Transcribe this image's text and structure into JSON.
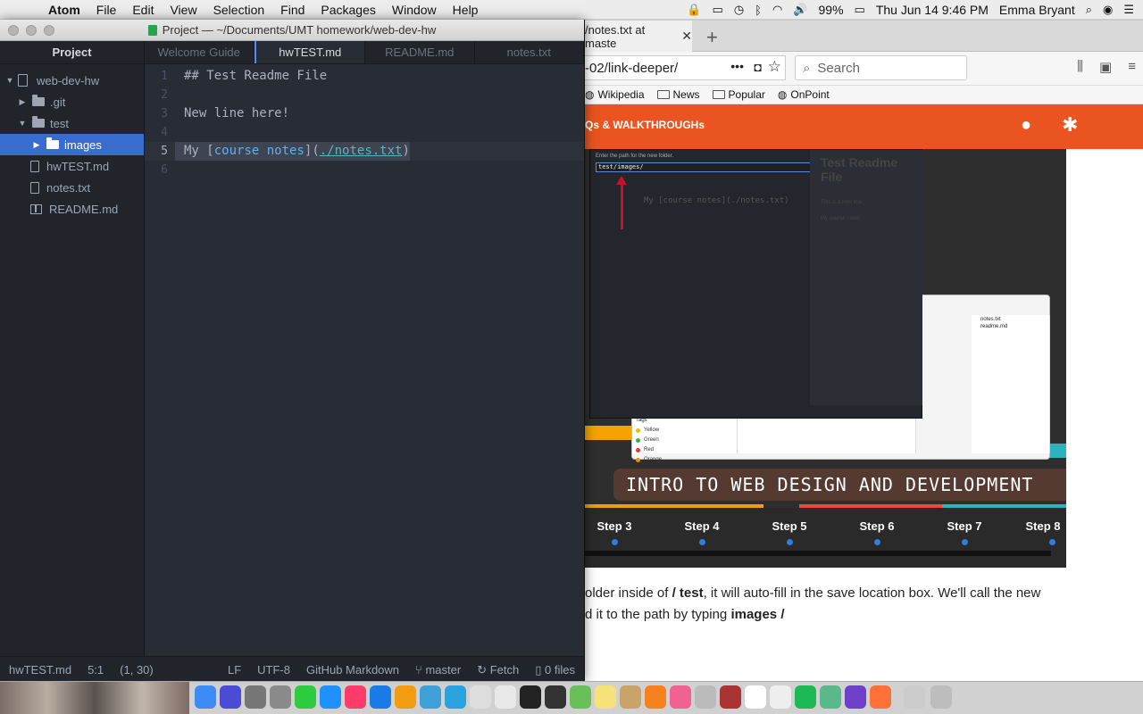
{
  "menubar": {
    "app_name": "Atom",
    "items": [
      "File",
      "Edit",
      "View",
      "Selection",
      "Find",
      "Packages",
      "Window",
      "Help"
    ],
    "battery": "99%",
    "datetime": "Thu Jun 14  9:46 PM",
    "user": "Emma Bryant"
  },
  "atom": {
    "window_title": "Project — ~/Documents/UMT homework/web-dev-hw",
    "tree_header": "Project",
    "tree": {
      "root": "web-dev-hw",
      "git": ".git",
      "test": "test",
      "images": "images",
      "hwtest": "hwTEST.md",
      "notes": "notes.txt",
      "readme": "README.md"
    },
    "tabs": [
      "Welcome Guide",
      "hwTEST.md",
      "README.md",
      "notes.txt"
    ],
    "lines": {
      "n1": "1",
      "n2": "2",
      "n3": "3",
      "n4": "4",
      "n5": "5",
      "n6": "6",
      "l1": "## Test Readme File",
      "l3": "New line here!",
      "l5_prefix": "My ",
      "l5_open": "[",
      "l5_link": "course notes",
      "l5_mid": "](",
      "l5_url": "./notes.txt",
      "l5_close": ")"
    },
    "status": {
      "file": "hwTEST.md",
      "cursor": "5:1",
      "selection": "(1, 30)",
      "eol": "LF",
      "encoding": "UTF-8",
      "grammar": "GitHub Markdown",
      "branch": "master",
      "fetch": "Fetch",
      "files": "0 files"
    }
  },
  "browser": {
    "tab_title": "/notes.txt at maste",
    "url": "-02/link-deeper/",
    "search_placeholder": "Search",
    "bookmarks": [
      "Wikipedia",
      "News",
      "Popular",
      "OnPoint"
    ],
    "site_nav": "Qs & WALKTHROUGHs",
    "screenshot": {
      "prompt": "Enter the path for the new folder.",
      "input": "test/images/",
      "preview_heading": "Test Readme File",
      "preview_p1": "This is a new line.",
      "preview_p2": "My course notes",
      "md": "My [course notes](./notes.txt)",
      "finder_rows": [
        "notes.txt",
        "readme.md"
      ],
      "tags_label": "Tags",
      "tags": [
        "Yellow",
        "Green",
        "Red",
        "Orange"
      ],
      "tag_colors": [
        "#e5c100",
        "#3cb043",
        "#e53935",
        "#f08c00"
      ],
      "banner": "INTRO TO WEB DESIGN AND DEVELOPMENT",
      "steps": [
        "Step 3",
        "Step 4",
        "Step 5",
        "Step 6",
        "Step 7",
        "Step 8"
      ]
    },
    "para_line1_a": "older inside of ",
    "para_line1_b": "/ test",
    "para_line1_c": ", it will auto-fill in the save location box. We'll call the new",
    "para_line2_a": "d it to the path by typing ",
    "para_line2_b": "images /"
  },
  "colors": {
    "accent_tab": "#568af2",
    "selection": "#3a6ccf",
    "site_orange": "#e95420",
    "heading_red": "#e06c75"
  }
}
